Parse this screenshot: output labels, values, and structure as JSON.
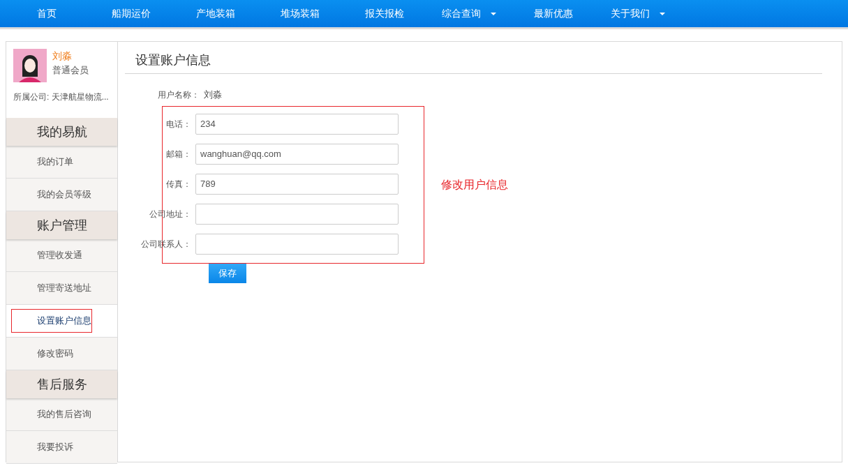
{
  "nav": [
    {
      "label": "首页",
      "dropdown": false
    },
    {
      "label": "船期运价",
      "dropdown": false
    },
    {
      "label": "产地装箱",
      "dropdown": false
    },
    {
      "label": "堆场装箱",
      "dropdown": false
    },
    {
      "label": "报关报检",
      "dropdown": false
    },
    {
      "label": "综合查询",
      "dropdown": true
    },
    {
      "label": "最新优惠",
      "dropdown": false
    },
    {
      "label": "关于我们",
      "dropdown": true
    }
  ],
  "user": {
    "name": "刘淼",
    "level": "普通会员",
    "company": "所属公司: 天津航星物流..."
  },
  "sidebar": [
    {
      "kind": "header",
      "label": "我的易航"
    },
    {
      "kind": "item",
      "label": "我的订单",
      "selected": false
    },
    {
      "kind": "item",
      "label": "我的会员等级",
      "selected": false
    },
    {
      "kind": "header",
      "label": "账户管理"
    },
    {
      "kind": "item",
      "label": "管理收发通",
      "selected": false
    },
    {
      "kind": "item",
      "label": "管理寄送地址",
      "selected": false
    },
    {
      "kind": "item",
      "label": "设置账户信息",
      "selected": true
    },
    {
      "kind": "item",
      "label": "修改密码",
      "selected": false
    },
    {
      "kind": "header",
      "label": "售后服务"
    },
    {
      "kind": "item",
      "label": "我的售后咨询",
      "selected": false
    },
    {
      "kind": "item",
      "label": "我要投诉",
      "selected": false
    }
  ],
  "page_title": "设置账户信息",
  "username": {
    "label": "用户名称：",
    "value": "刘淼"
  },
  "fields": [
    {
      "label": "电话：",
      "value": "234"
    },
    {
      "label": "邮箱：",
      "value": "wanghuan@qq.com"
    },
    {
      "label": "传真：",
      "value": "789"
    },
    {
      "label": "公司地址："
    },
    {
      "label": "公司联系人："
    }
  ],
  "save_button": "保存",
  "annotation": "修改用户信息"
}
